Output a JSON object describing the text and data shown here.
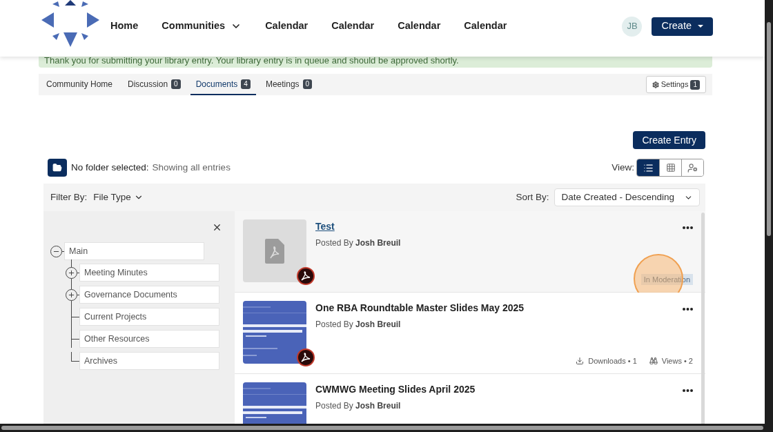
{
  "nav": {
    "items": [
      {
        "label": "Home",
        "kind": "link"
      },
      {
        "label": "Communities",
        "kind": "dropdown"
      },
      {
        "label": "Calendar",
        "kind": "link"
      },
      {
        "label": "Calendar",
        "kind": "link"
      },
      {
        "label": "Calendar",
        "kind": "link"
      },
      {
        "label": "Calendar",
        "kind": "link"
      }
    ],
    "avatar": "JB",
    "create": "Create"
  },
  "banner": "Thank you for submitting your library entry. Your library entry is in queue and should be approved shortly.",
  "tabs": [
    {
      "label": "Community Home",
      "selected": false
    },
    {
      "label": "Discussion",
      "count": "0",
      "selected": false
    },
    {
      "label": "Documents",
      "count": "4",
      "selected": true
    },
    {
      "label": "Meetings",
      "count": "0",
      "selected": false
    }
  ],
  "settings": {
    "label": "Settings",
    "count": "1"
  },
  "create_entry": "Create Entry",
  "folder_status": {
    "label": "No folder selected:",
    "value": "Showing all entries"
  },
  "view": {
    "label": "View:",
    "options": [
      {
        "kind": "list",
        "selected": true
      },
      {
        "kind": "grid",
        "selected": false
      },
      {
        "kind": "people",
        "selected": false
      }
    ]
  },
  "filter": {
    "label": "Filter By:",
    "value": "File Type"
  },
  "sort": {
    "label": "Sort By:",
    "value": "Date Created - Descending"
  },
  "tree": {
    "label": "Main",
    "expanded": true,
    "children": [
      {
        "label": "Meeting Minutes",
        "expandable": true
      },
      {
        "label": "Governance Documents",
        "expandable": true
      },
      {
        "label": "Current Projects",
        "expandable": false
      },
      {
        "label": "Other Resources",
        "expandable": false
      },
      {
        "label": "Archives",
        "expandable": false
      }
    ]
  },
  "entries": [
    {
      "title": "Test",
      "linked": true,
      "thumbnail": {
        "kind": "placeholder"
      },
      "pdf_badge": true,
      "posted_label": "Posted By",
      "author": "Josh Breuil",
      "status": "In Moderation",
      "highlighted": true
    },
    {
      "title": "One RBA Roundtable Master Slides May 2025",
      "linked": false,
      "thumbnail": {
        "kind": "picture"
      },
      "pdf_badge": true,
      "posted_label": "Posted By",
      "author": "Josh Breuil",
      "highlighted": false,
      "stats": [
        {
          "kind": "downloads",
          "label": "Downloads • 1"
        },
        {
          "kind": "views",
          "label": "Views • 2"
        }
      ]
    },
    {
      "title": "CWMWG Meeting Slides April 2025",
      "linked": false,
      "thumbnail": {
        "kind": "picture"
      },
      "pdf_badge": false,
      "posted_label": "Posted By",
      "author": "Josh Breuil",
      "highlighted": false
    }
  ]
}
